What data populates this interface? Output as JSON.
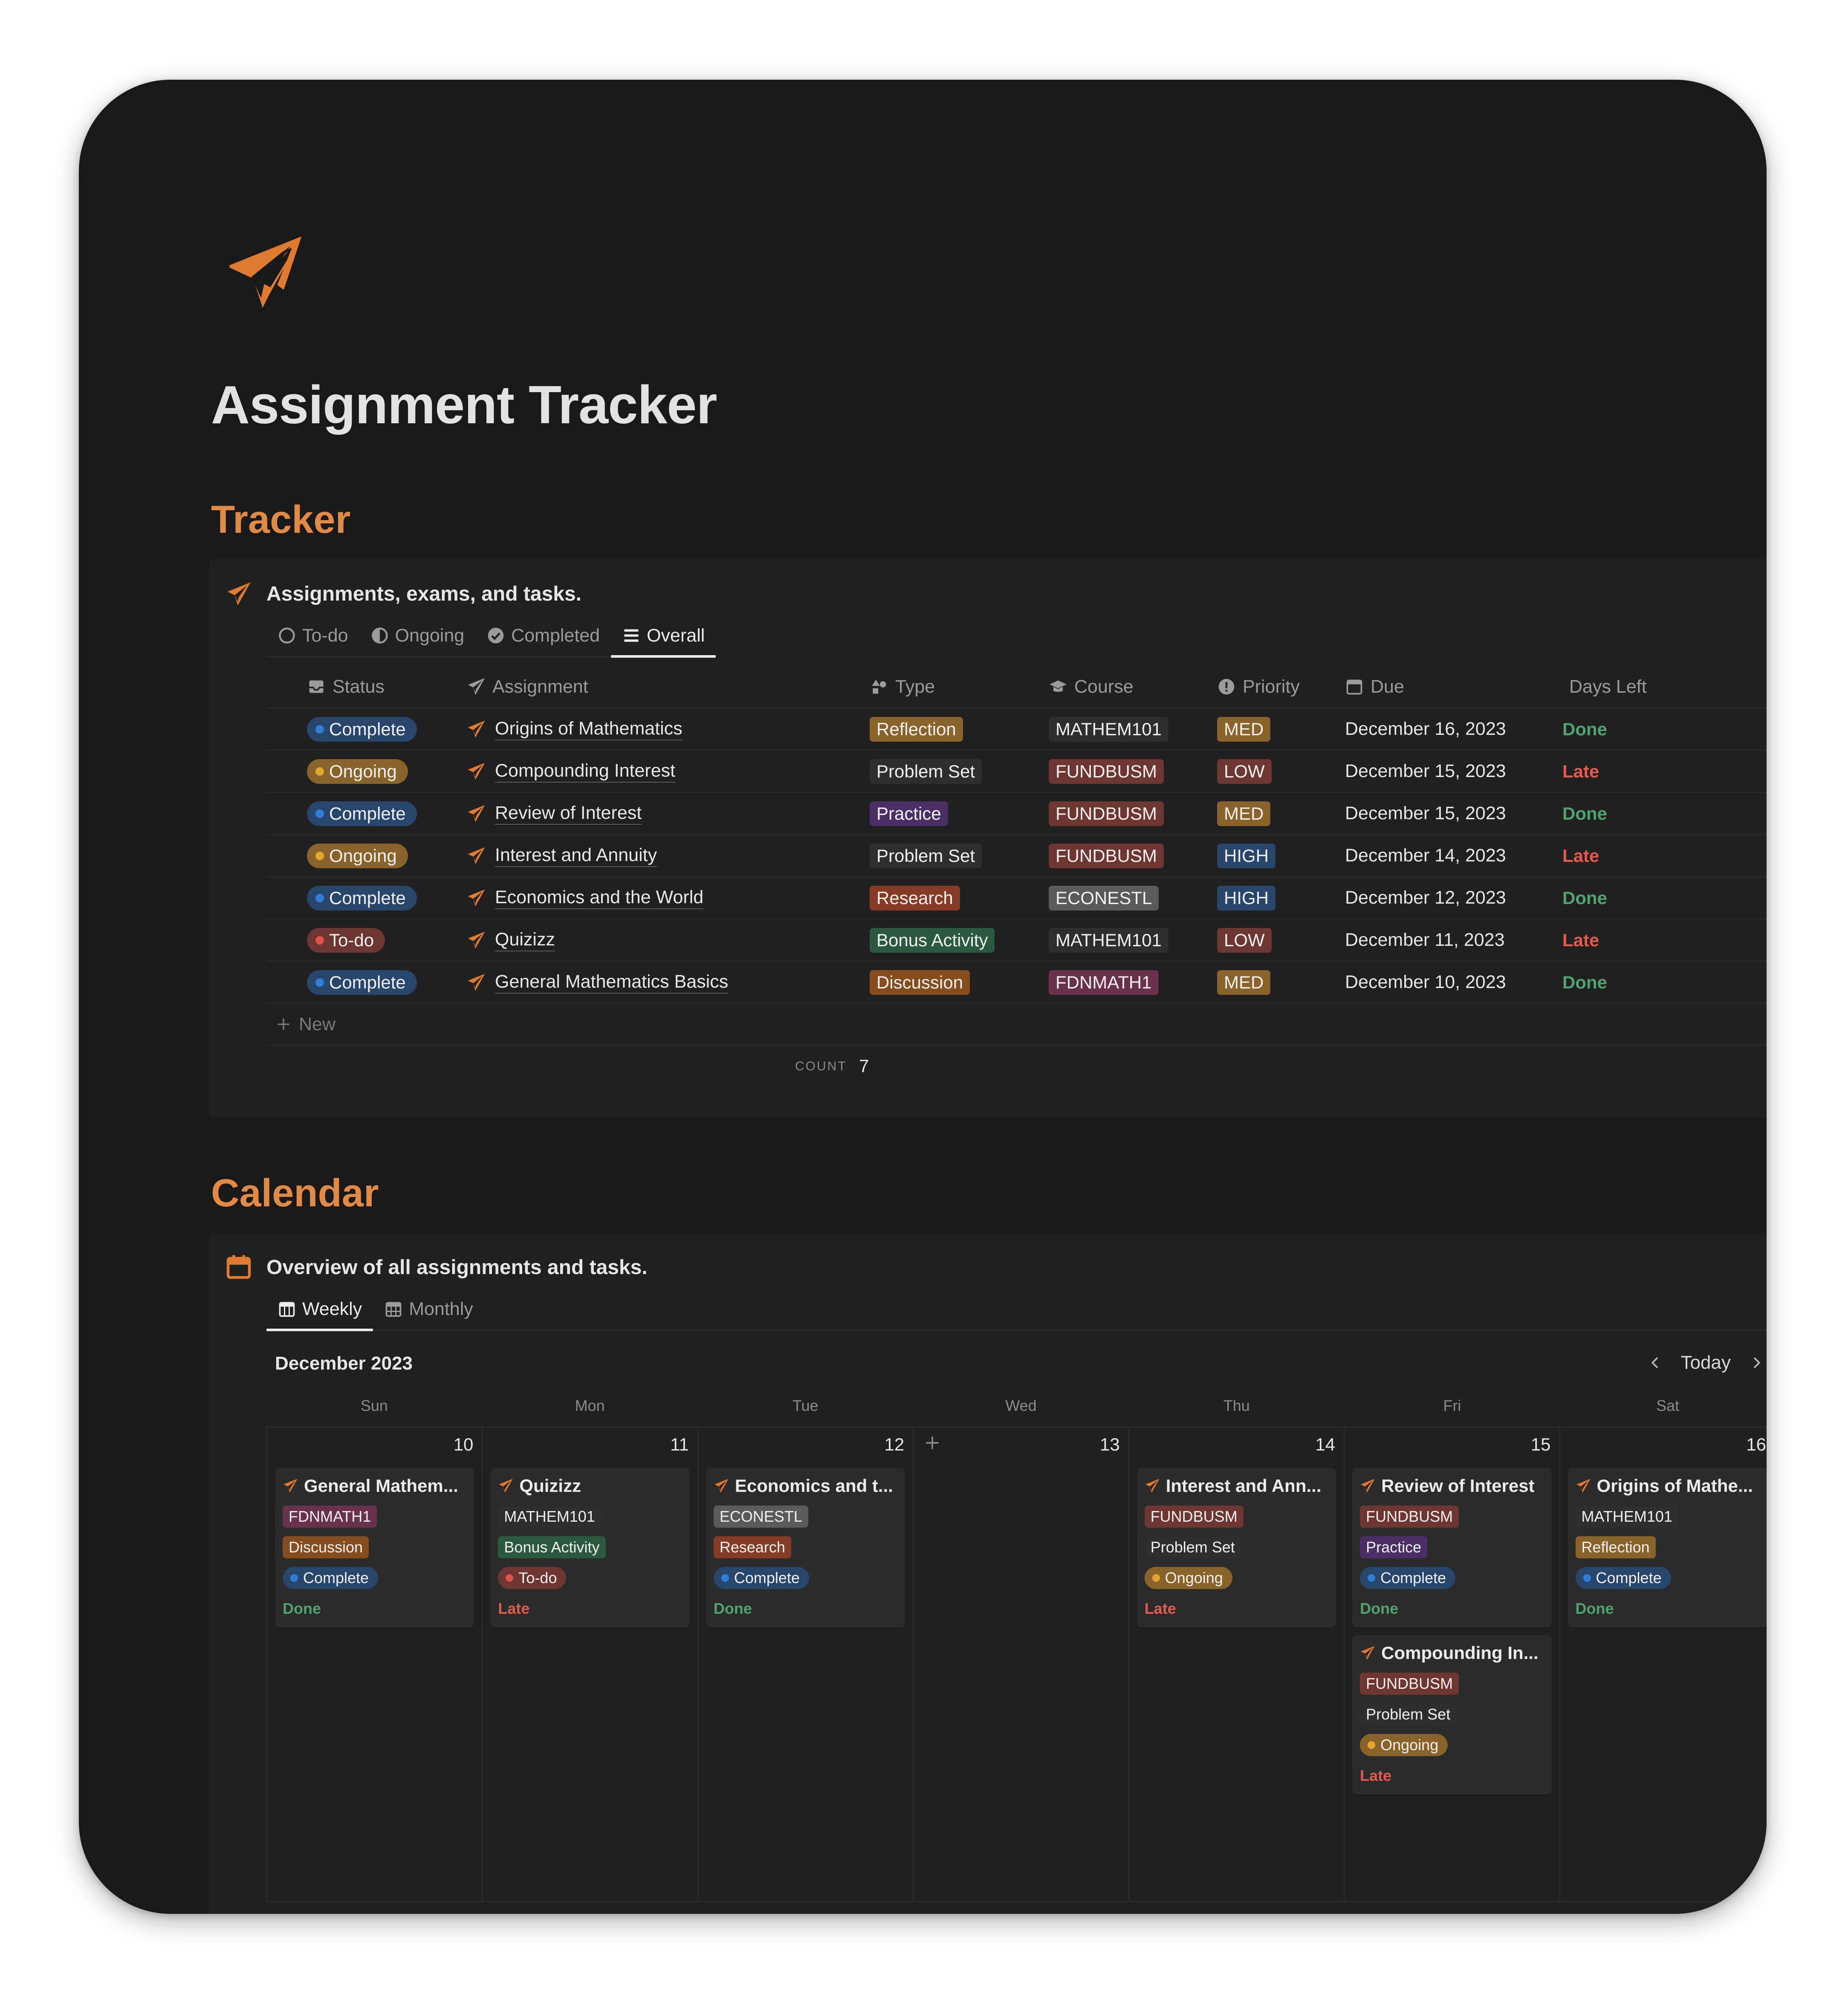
{
  "page": {
    "title": "Assignment Tracker"
  },
  "tracker": {
    "heading": "Tracker",
    "caption": "Assignments, exams, and tasks.",
    "tabs": [
      {
        "label": "To-do",
        "icon": "circle-icon"
      },
      {
        "label": "Ongoing",
        "icon": "half-circle-icon"
      },
      {
        "label": "Completed",
        "icon": "check-circle-icon"
      },
      {
        "label": "Overall",
        "icon": "list-icon"
      }
    ],
    "columns": {
      "status": "Status",
      "assignment": "Assignment",
      "type": "Type",
      "course": "Course",
      "priority": "Priority",
      "due": "Due",
      "days_left": "Days Left"
    },
    "rows": [
      {
        "status": "Complete",
        "assignment": "Origins of Mathematics",
        "type": "Reflection",
        "course": "MATHEM101",
        "priority": "MED",
        "due": "December 16, 2023",
        "days_left": "Done"
      },
      {
        "status": "Ongoing",
        "assignment": "Compounding Interest",
        "type": "Problem Set",
        "course": "FUNDBUSM",
        "priority": "LOW",
        "due": "December 15, 2023",
        "days_left": "Late"
      },
      {
        "status": "Complete",
        "assignment": "Review of Interest",
        "type": "Practice",
        "course": "FUNDBUSM",
        "priority": "MED",
        "due": "December 15, 2023",
        "days_left": "Done"
      },
      {
        "status": "Ongoing",
        "assignment": "Interest and Annuity",
        "type": "Problem Set",
        "course": "FUNDBUSM",
        "priority": "HIGH",
        "due": "December 14, 2023",
        "days_left": "Late"
      },
      {
        "status": "Complete",
        "assignment": "Economics and the World",
        "type": "Research",
        "course": "ECONESTL",
        "priority": "HIGH",
        "due": "December 12, 2023",
        "days_left": "Done"
      },
      {
        "status": "To-do",
        "assignment": "Quizizz",
        "type": "Bonus Activity",
        "course": "MATHEM101",
        "priority": "LOW",
        "due": "December 11, 2023",
        "days_left": "Late"
      },
      {
        "status": "Complete",
        "assignment": "General Mathematics Basics",
        "type": "Discussion",
        "course": "FDNMATH1",
        "priority": "MED",
        "due": "December 10, 2023",
        "days_left": "Done"
      }
    ],
    "new_label": "New",
    "count_label": "COUNT",
    "count_value": "7"
  },
  "calendar": {
    "heading": "Calendar",
    "caption": "Overview of all assignments and tasks.",
    "tabs": [
      {
        "label": "Weekly",
        "icon": "calendar-week-icon"
      },
      {
        "label": "Monthly",
        "icon": "calendar-month-icon"
      }
    ],
    "month": "December 2023",
    "today_label": "Today",
    "weekdays": [
      "Sun",
      "Mon",
      "Tue",
      "Wed",
      "Thu",
      "Fri",
      "Sat"
    ],
    "days": [
      {
        "num": "10",
        "cards": [
          {
            "title": "General Mathem...",
            "course": "FDNMATH1",
            "type": "Discussion",
            "status": "Complete",
            "days_left": "Done"
          }
        ]
      },
      {
        "num": "11",
        "cards": [
          {
            "title": "Quizizz",
            "course": "MATHEM101",
            "type": "Bonus Activity",
            "status": "To-do",
            "days_left": "Late"
          }
        ]
      },
      {
        "num": "12",
        "cards": [
          {
            "title": "Economics and t...",
            "course": "ECONESTL",
            "type": "Research",
            "status": "Complete",
            "days_left": "Done"
          }
        ]
      },
      {
        "num": "13",
        "cards": []
      },
      {
        "num": "14",
        "cards": [
          {
            "title": "Interest and Ann...",
            "course": "FUNDBUSM",
            "type": "Problem Set",
            "status": "Ongoing",
            "days_left": "Late"
          }
        ]
      },
      {
        "num": "15",
        "cards": [
          {
            "title": "Review of Interest",
            "course": "FUNDBUSM",
            "type": "Practice",
            "status": "Complete",
            "days_left": "Done"
          },
          {
            "title": "Compounding In...",
            "course": "FUNDBUSM",
            "type": "Problem Set",
            "status": "Ongoing",
            "days_left": "Late"
          }
        ]
      },
      {
        "num": "16",
        "cards": [
          {
            "title": "Origins of Mathe...",
            "course": "MATHEM101",
            "type": "Reflection",
            "status": "Complete",
            "days_left": "Done"
          }
        ]
      }
    ]
  },
  "colors": {
    "accent": "#e07a2f",
    "status": {
      "Complete": {
        "bg": "#28456c",
        "dot": "#2f7fd8"
      },
      "Ongoing": {
        "bg": "#89632a",
        "dot": "#e3a52b"
      },
      "To-do": {
        "bg": "#6e3630",
        "dot": "#e0524b"
      }
    },
    "type": {
      "Reflection": "#89632a",
      "Problem Set": "#2e2e2e",
      "Practice": "#492f64",
      "Research": "#853b24",
      "Bonus Activity": "#2b593f",
      "Discussion": "#854c1d"
    },
    "course": {
      "MATHEM101": "#2e2e2e",
      "FUNDBUSM": "#6e3630",
      "ECONESTL": "#5a5a5a",
      "FDNMATH1": "#69314c"
    },
    "priority": {
      "MED": "#89632a",
      "LOW": "#6e3630",
      "HIGH": "#28456c"
    },
    "days_left": {
      "Done": "#4fa36f",
      "Late": "#e35a4f"
    }
  }
}
